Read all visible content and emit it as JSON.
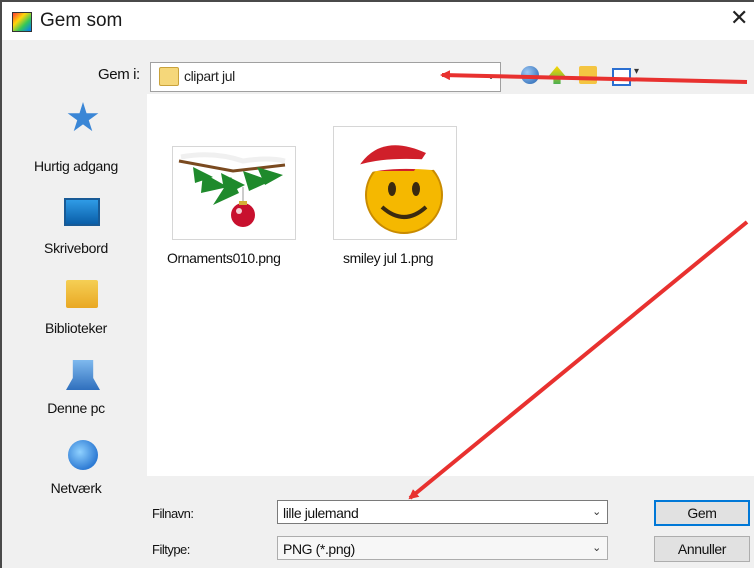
{
  "dialog": {
    "title": "Gem som",
    "close_glyph": "✕",
    "icons": {
      "app": "paint-app-icon",
      "close": "close-icon"
    }
  },
  "save_in": {
    "label": "Gem i:",
    "value": "clipart jul",
    "icon": "folder-icon"
  },
  "toolbar": {
    "items": [
      "back-icon",
      "up-folder-icon",
      "new-folder-icon",
      "view-menu-icon"
    ]
  },
  "places": [
    {
      "label": "Hurtig adgang",
      "icon": "star-icon"
    },
    {
      "label": "Skrivebord",
      "icon": "desktop-icon"
    },
    {
      "label": "Biblioteker",
      "icon": "libraries-icon"
    },
    {
      "label": "Denne pc",
      "icon": "computer-icon"
    },
    {
      "label": "Netværk",
      "icon": "network-icon"
    }
  ],
  "files": [
    {
      "name": "Ornaments010.png",
      "thumb": "christmas-ornament-thumbnail"
    },
    {
      "name": "smiley jul 1.png",
      "thumb": "santa-smiley-thumbnail"
    }
  ],
  "filename": {
    "label": "Filnavn:",
    "value": "lille julemand"
  },
  "filetype": {
    "label": "Filtype:",
    "value": "PNG (*.png)"
  },
  "buttons": {
    "save": "Gem",
    "cancel": "Annuller"
  },
  "colors": {
    "annotation_arrow": "#e8312f",
    "accent": "#0078d7"
  }
}
